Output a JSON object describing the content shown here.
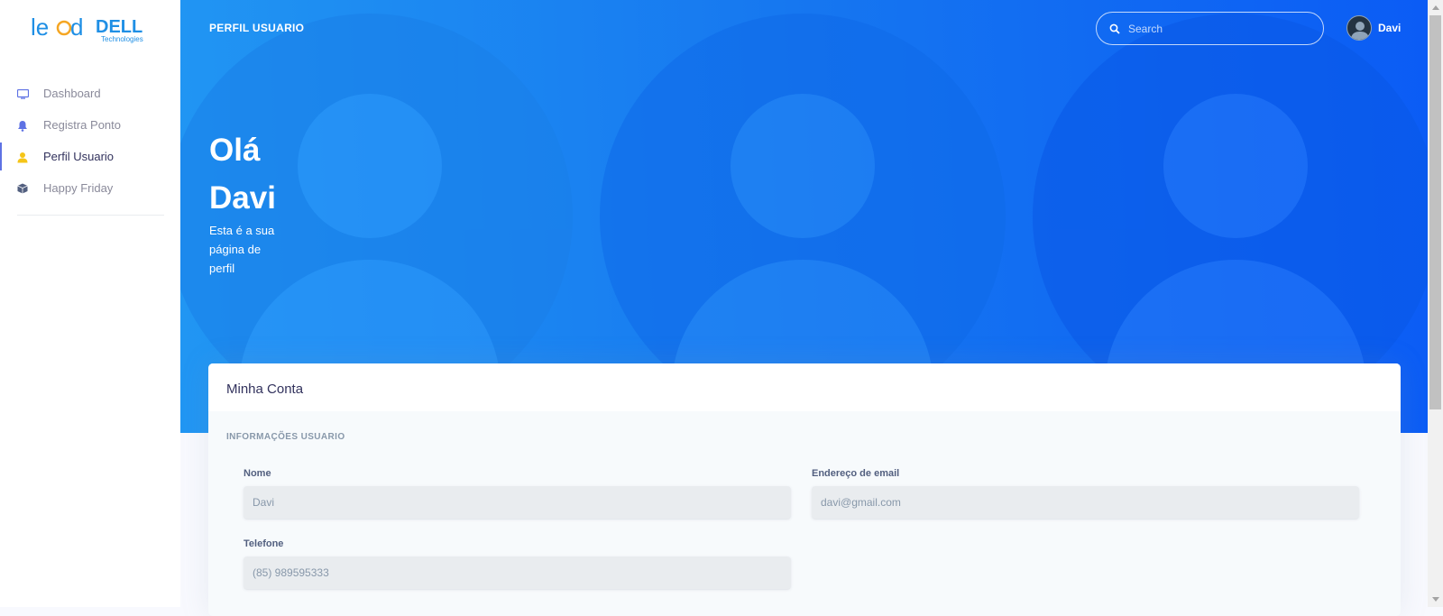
{
  "colors": {
    "hero_gradient_start": "#2196f3",
    "hero_gradient_end": "#0b5cf5",
    "active_nav_icon": "#f5c518",
    "nav_text": "#8a8a9a",
    "active_nav_text": "#32325d"
  },
  "sidebar": {
    "items": [
      {
        "label": "Dashboard",
        "icon": "monitor-icon",
        "active": false
      },
      {
        "label": "Registra Ponto",
        "icon": "bell-icon",
        "active": false
      },
      {
        "label": "Perfil Usuario",
        "icon": "user-icon",
        "active": true
      },
      {
        "label": "Happy Friday",
        "icon": "box-icon",
        "active": false
      }
    ]
  },
  "header": {
    "title": "PERFIL USUARIO",
    "search_placeholder": "Search",
    "user_name": "Davi"
  },
  "hero": {
    "greeting": "Olá Davi",
    "subtitle": "Esta é a sua página de perfil"
  },
  "account": {
    "title": "Minha Conta",
    "section_title": "INFORMAÇÕES USUARIO",
    "fields": {
      "name_label": "Nome",
      "name_value": "Davi",
      "email_label": "Endereço de email",
      "email_value": "davi@gmail.com",
      "phone_label": "Telefone",
      "phone_value": "(85) 989595333"
    }
  }
}
